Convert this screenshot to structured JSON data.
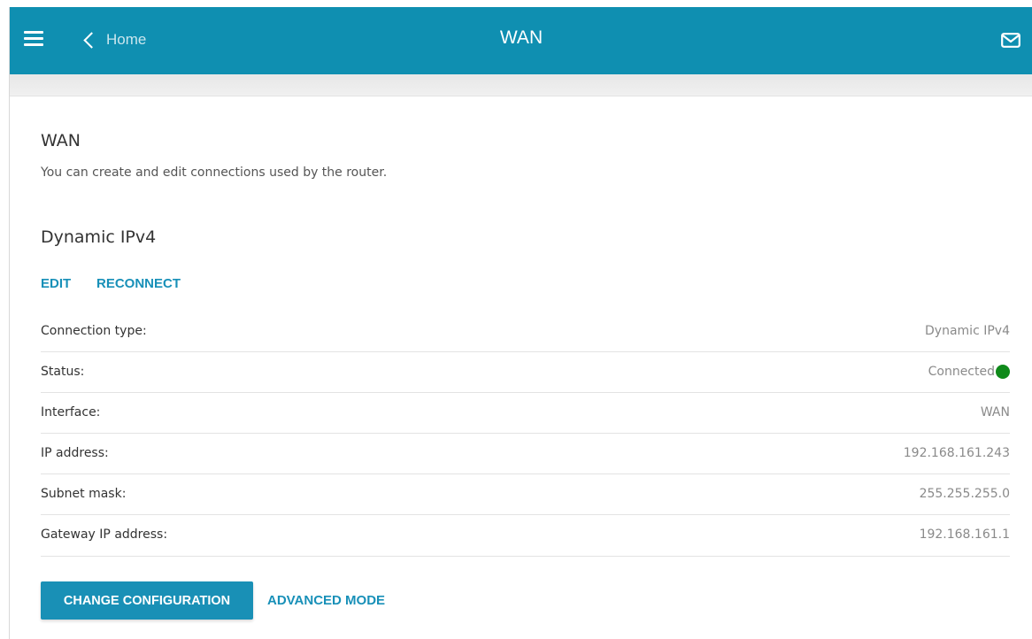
{
  "header": {
    "back_label": "Home",
    "title": "WAN",
    "icons": {
      "menu": "menu-icon",
      "back": "chevron-left-icon",
      "messages": "mail-icon"
    },
    "color": "#0f8fb1"
  },
  "section": {
    "title": "WAN",
    "description": "You can create and edit connections used by the router."
  },
  "connection": {
    "name": "Dynamic IPv4",
    "actions": {
      "edit": "EDIT",
      "reconnect": "RECONNECT"
    },
    "info": [
      {
        "label": "Connection type:",
        "value": "Dynamic IPv4"
      },
      {
        "label": "Status:",
        "value": "Connected",
        "status_color": "#0f8a1a"
      },
      {
        "label": "Interface:",
        "value": "WAN"
      },
      {
        "label": "IP address:",
        "value": "192.168.161.243"
      },
      {
        "label": "Subnet mask:",
        "value": "255.255.255.0"
      },
      {
        "label": "Gateway IP address:",
        "value": "192.168.161.1"
      }
    ]
  },
  "footer": {
    "change_config": "CHANGE CONFIGURATION",
    "advanced_mode": "ADVANCED MODE"
  },
  "colors": {
    "accent": "#1890b8",
    "status_ok": "#0f8a1a"
  }
}
